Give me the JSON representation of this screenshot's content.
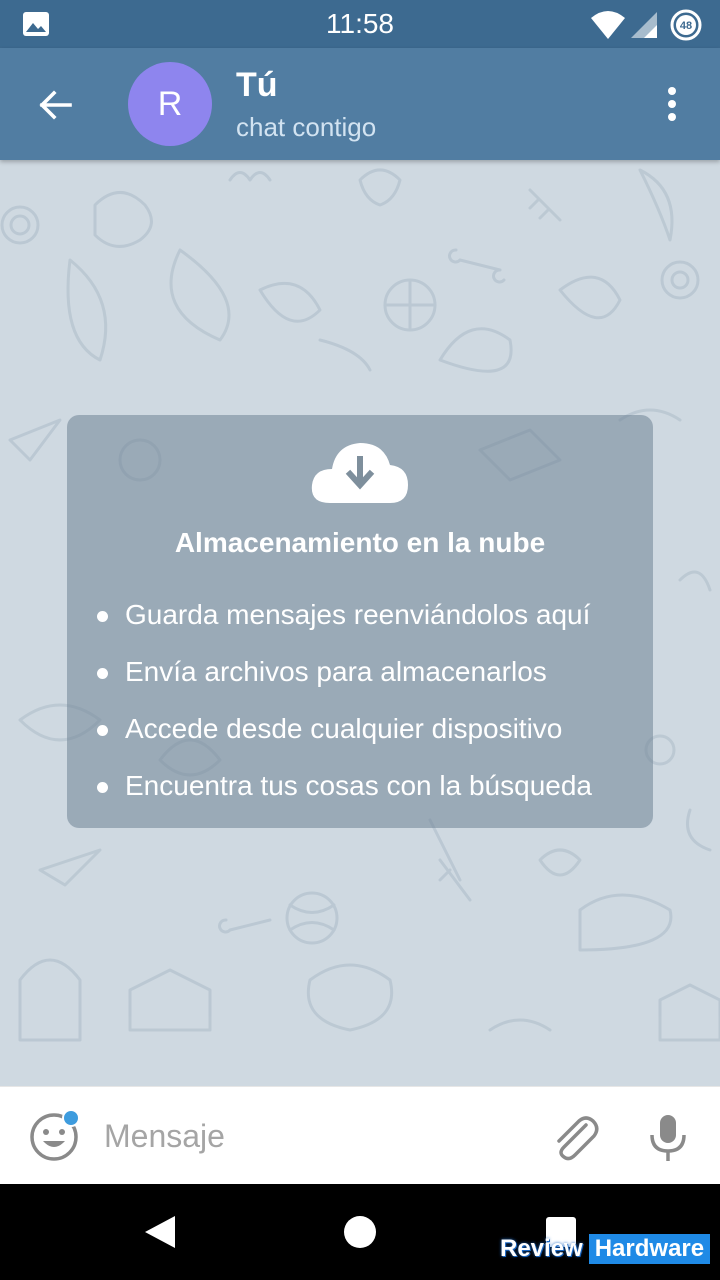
{
  "status_bar": {
    "time": "11:58",
    "battery_level": "48",
    "icons": [
      "gallery-icon",
      "wifi-icon",
      "cell-signal-icon",
      "battery-icon"
    ]
  },
  "header": {
    "avatar_letter": "R",
    "title": "Tú",
    "subtitle": "chat contigo",
    "avatar_color": "#8e85ee",
    "bar_color": "#517da2"
  },
  "info_card": {
    "icon": "cloud-download-icon",
    "title": "Almacenamiento en la nube",
    "items": [
      "Guarda mensajes reenviándolos aquí",
      "Envía archivos para almacenarlos",
      "Accede desde cualquier dispositivo",
      "Encuentra tus cosas con la búsqueda"
    ]
  },
  "input_bar": {
    "placeholder": "Mensaje",
    "icons": [
      "emoji-icon",
      "paperclip-icon",
      "microphone-icon"
    ],
    "badge_color": "#3e9cde"
  },
  "watermark": {
    "part1": "Review",
    "part2": "Hardware"
  }
}
